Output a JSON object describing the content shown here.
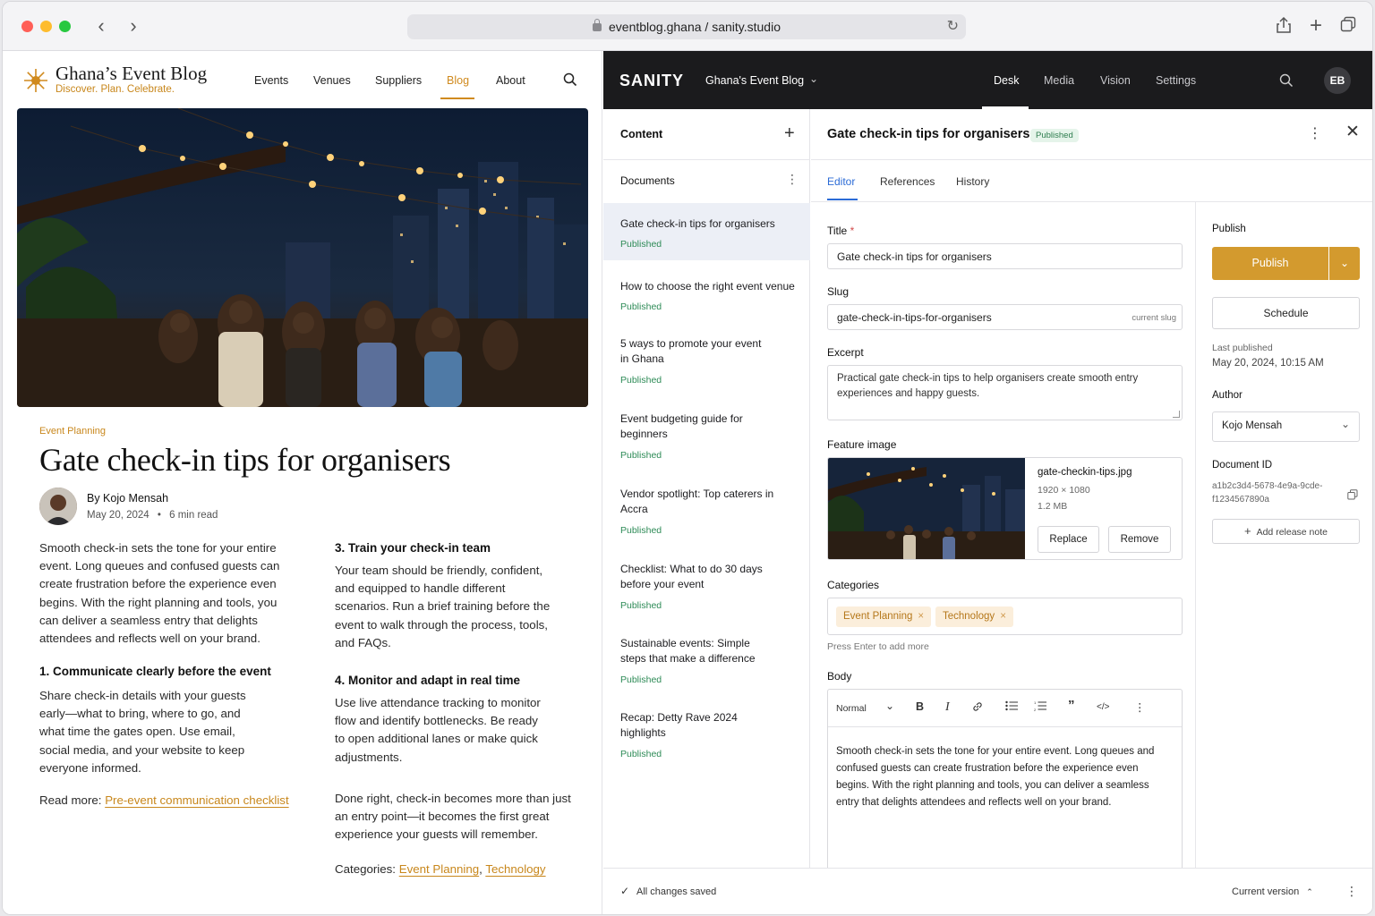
{
  "browser": {
    "url": "eventblog.ghana / sanity.studio"
  },
  "blog": {
    "brand_name": "Ghana’s Event Blog",
    "brand_tagline": "Discover. Plan. Celebrate.",
    "nav": [
      "Events",
      "Venues",
      "Suppliers",
      "Blog",
      "About"
    ],
    "active_nav": "Blog",
    "category_eyebrow": "Event Planning",
    "title": "Gate check-in tips for organisers",
    "author": "By Kojo Mensah",
    "date": "May 20, 2024",
    "read_time": "6 min read",
    "intro": "Smooth check-in sets the tone for your entire event. Long queues and confused guests can create frustration before the experience even begins. With the right planning and tools, you can deliver a seamless entry that delights attendees and reflects well on your brand.",
    "section1_title": "1. Communicate clearly before the event",
    "section1_body": "Share check-in details with your guests early—what to bring, where to go, and what time the gates open. Use email, social media, and your website to keep everyone informed.",
    "read_more_label": "Read more:",
    "read_more_link": "Pre-event communication checklist",
    "section3_title": "3. Train your check-in team",
    "section3_body": "Your team should be friendly, confident, and equipped to handle different scenarios. Run a brief training before the event to walk through the process, tools, and FAQs.",
    "section4_title": "4. Monitor and adapt in real time",
    "section4_body": "Use live attendance tracking to monitor flow and identify bottlenecks. Be ready to open additional lanes or make quick adjustments.",
    "closing": "Done right, check-in becomes more than just an entry point—it becomes the first great experience your guests will remember.",
    "categories_label": "Categories:",
    "categories": [
      "Event Planning",
      "Technology"
    ]
  },
  "sanity": {
    "logo": "SANITY",
    "workspace": "Ghana's Event Blog",
    "tabs": [
      "Desk",
      "Media",
      "Vision",
      "Settings"
    ],
    "active_tab": "Desk",
    "user_initials": "EB",
    "content_title": "Content",
    "documents_title": "Documents",
    "documents": [
      {
        "title": "Gate check-in tips for organisers",
        "status": "Published"
      },
      {
        "title": "How to choose the right event venue",
        "status": "Published"
      },
      {
        "title": "5 ways to promote your event in Ghana",
        "status": "Published"
      },
      {
        "title": "Event budgeting guide for beginners",
        "status": "Published"
      },
      {
        "title": "Vendor spotlight: Top caterers in Accra",
        "status": "Published"
      },
      {
        "title": "Checklist: What to do 30 days before your event",
        "status": "Published"
      },
      {
        "title": "Sustainable events: Simple steps that make a difference",
        "status": "Published"
      },
      {
        "title": "Recap: Detty Rave 2024 highlights",
        "status": "Published"
      }
    ],
    "editor": {
      "doc_title": "Gate check-in tips for organisers",
      "badge": "Published",
      "tabs": [
        "Editor",
        "References",
        "History"
      ],
      "title_label": "Title",
      "title_value": "Gate check-in tips for organisers",
      "slug_label": "Slug",
      "slug_value": "gate-check-in-tips-for-organisers",
      "slug_hint": "current slug",
      "excerpt_label": "Excerpt",
      "excerpt_value": "Practical gate check-in tips to help organisers create smooth entry experiences and happy guests.",
      "image_label": "Feature image",
      "image_name": "gate-checkin-tips.jpg",
      "image_dims": "1920 × 1080",
      "image_size": "1.2 MB",
      "replace_label": "Replace",
      "remove_label": "Remove",
      "categories_label": "Categories",
      "categories": [
        "Event Planning",
        "Technology"
      ],
      "categories_hint": "Press Enter to add more",
      "body_label": "Body",
      "style_select": "Normal",
      "body_text": "Smooth check-in sets the tone for your entire event. Long queues and confused guests can create frustration before the experience even begins. With the right planning and tools, you can deliver a seamless entry that delights attendees and reflects well on your brand."
    },
    "publish": {
      "heading": "Publish",
      "publish_button": "Publish",
      "schedule_button": "Schedule",
      "last_published_label": "Last published",
      "last_published_value": "May 20, 2024, 10:15 AM",
      "author_label": "Author",
      "author_value": "Kojo Mensah",
      "docid_label": "Document ID",
      "docid_value": "a1b2c3d4-5678-4e9a-9cde-f1234567890a",
      "release_note": "Add release note"
    },
    "footer": {
      "saved": "All changes saved",
      "version": "Current version"
    }
  },
  "colors": {
    "accent": "#d08a1e",
    "publish": "#d39a2e",
    "link_blue": "#2b6bd6",
    "published_green": "#2e8b57"
  }
}
